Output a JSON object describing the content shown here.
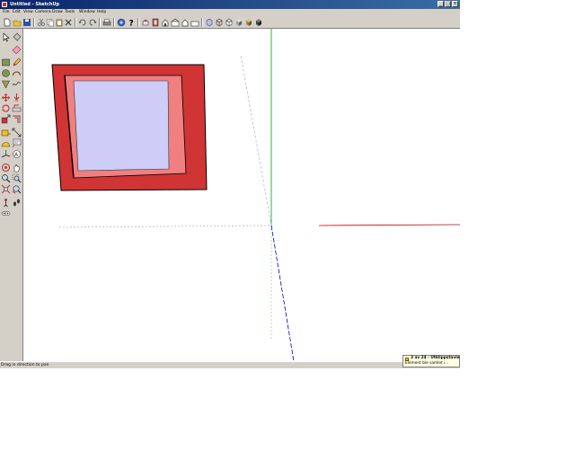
{
  "window": {
    "title": "Untitled - SketchUp",
    "buttons": {
      "minimize": "_",
      "maximize": "□",
      "close": "×"
    }
  },
  "menu": [
    "File",
    "Edit",
    "View",
    "Camera",
    "Draw",
    "Tools",
    "Window",
    "Help"
  ],
  "toolbar": {
    "buttons": [
      "new",
      "open",
      "save",
      "cut",
      "copy",
      "paste",
      "erase",
      "undo",
      "redo",
      "print",
      "model-info",
      "help",
      "iso",
      "top",
      "front",
      "right",
      "back",
      "left",
      "xray",
      "wireframe",
      "hidden-line",
      "shaded",
      "shaded-textures",
      "monochrome"
    ]
  },
  "tools": [
    "select",
    "paint-bucket",
    "rectangle",
    "line",
    "circle",
    "arc",
    "polygon",
    "freehand",
    "move",
    "push-pull",
    "rotate",
    "follow-me",
    "scale",
    "offset",
    "tape-measure",
    "dimension",
    "protractor",
    "text",
    "axes",
    "3d-text",
    "orbit",
    "pan",
    "zoom",
    "zoom-window",
    "zoom-extents",
    "previous",
    "position-camera",
    "walk",
    "look-around",
    "section-plane"
  ],
  "colors": {
    "outer_face": "#d03434",
    "inner_rim": "#f07f7f",
    "back_face": "#cdcdf8",
    "red_axis": "#c00000",
    "green_axis": "#00a000",
    "blue_axis": "#0000c0"
  },
  "status": {
    "text": "Drag in direction to pan"
  },
  "tooltip": {
    "title": "3 av 24 - Utklippstavle",
    "body": "Element ble samlet i..."
  }
}
